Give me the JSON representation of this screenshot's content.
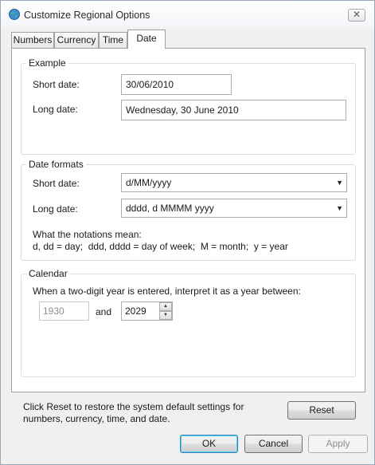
{
  "window": {
    "title": "Customize Regional Options",
    "close_label": "✕"
  },
  "tabs": [
    {
      "label": "Numbers"
    },
    {
      "label": "Currency"
    },
    {
      "label": "Time"
    },
    {
      "label": "Date"
    }
  ],
  "example": {
    "title": "Example",
    "short_label": "Short date:",
    "short_value": "30/06/2010",
    "long_label": "Long date:",
    "long_value": "Wednesday, 30 June 2010"
  },
  "date_formats": {
    "title": "Date formats",
    "short_label": "Short date:",
    "short_value": "d/MM/yyyy",
    "long_label": "Long date:",
    "long_value": "dddd, d MMMM yyyy",
    "notations_heading": "What the notations mean:",
    "notations_text": "d, dd = day;  ddd, dddd = day of week;  M = month;  y = year"
  },
  "calendar": {
    "title": "Calendar",
    "description": "When a two-digit year is entered, interpret it as a year between:",
    "year_start": "1930",
    "and_label": "and",
    "year_end": "2029"
  },
  "reset": {
    "text_line1": "Click Reset to restore the system default settings for",
    "text_line2": "numbers, currency, time, and date.",
    "button_label": "Reset"
  },
  "buttons": {
    "ok": "OK",
    "cancel": "Cancel",
    "apply": "Apply"
  }
}
